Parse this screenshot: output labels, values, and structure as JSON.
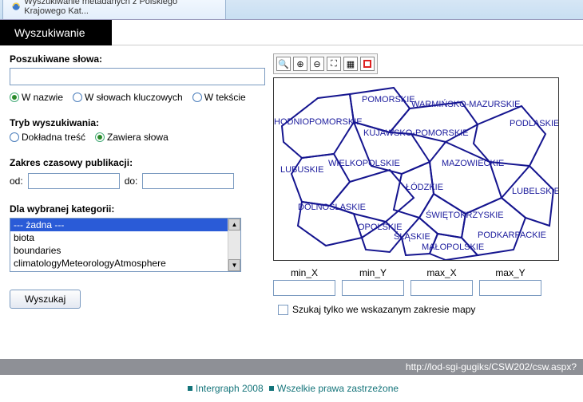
{
  "browser": {
    "tab_title": "Wyszukiwanie metadanych z Polskiego Krajowego Kat..."
  },
  "header": {
    "tab": "Wyszukiwanie"
  },
  "search": {
    "words_label": "Poszukiwane słowa:",
    "value": "",
    "radios": {
      "in_name": "W nazwie",
      "in_keywords": "W słowach kluczowych",
      "in_text": "W tekście"
    }
  },
  "mode": {
    "label": "Tryb wyszukiwania:",
    "exact": "Dokładna treść",
    "contains": "Zawiera słowa"
  },
  "daterange": {
    "label": "Zakres czasowy publikacji:",
    "from_label": "od:",
    "to_label": "do:",
    "from": "",
    "to": ""
  },
  "category": {
    "label": "Dla wybranej kategorii:",
    "items": [
      "--- żadna ---",
      "biota",
      "boundaries",
      "climatologyMeteorologyAtmosphere"
    ]
  },
  "buttons": {
    "search": "Wyszukaj"
  },
  "map": {
    "regions": [
      "HODNIOPOMORSKIE",
      "POMORSKIE",
      "WARMIŃSKO-MAZURSKIE",
      "PODLASKIE",
      "KUJAWSKO-POMORSKIE",
      "LUBUSKIE",
      "WIELKOPOLSKIE",
      "MAZOWIECKIE",
      "ŁÓDZKIE",
      "DOLNOŚLĄSKIE",
      "OPOLSKIE",
      "ŚLĄSKIE",
      "ŚWIĘTOKRZYSKIE",
      "MAŁOPOLSKIE",
      "PODKARPACKIE",
      "LUBELSKIE"
    ],
    "coords": {
      "minx_label": "min_X",
      "miny_label": "min_Y",
      "maxx_label": "max_X",
      "maxy_label": "max_Y",
      "minx": "",
      "miny": "",
      "maxx": "",
      "maxy": ""
    },
    "checkbox_label": "Szukaj tylko we wskazanym zakresie mapy"
  },
  "url": "http://lod-sgi-gugiks/CSW202/csw.aspx?",
  "footer": {
    "left": "Intergraph 2008",
    "right": "Wszelkie prawa zastrzeżone"
  }
}
